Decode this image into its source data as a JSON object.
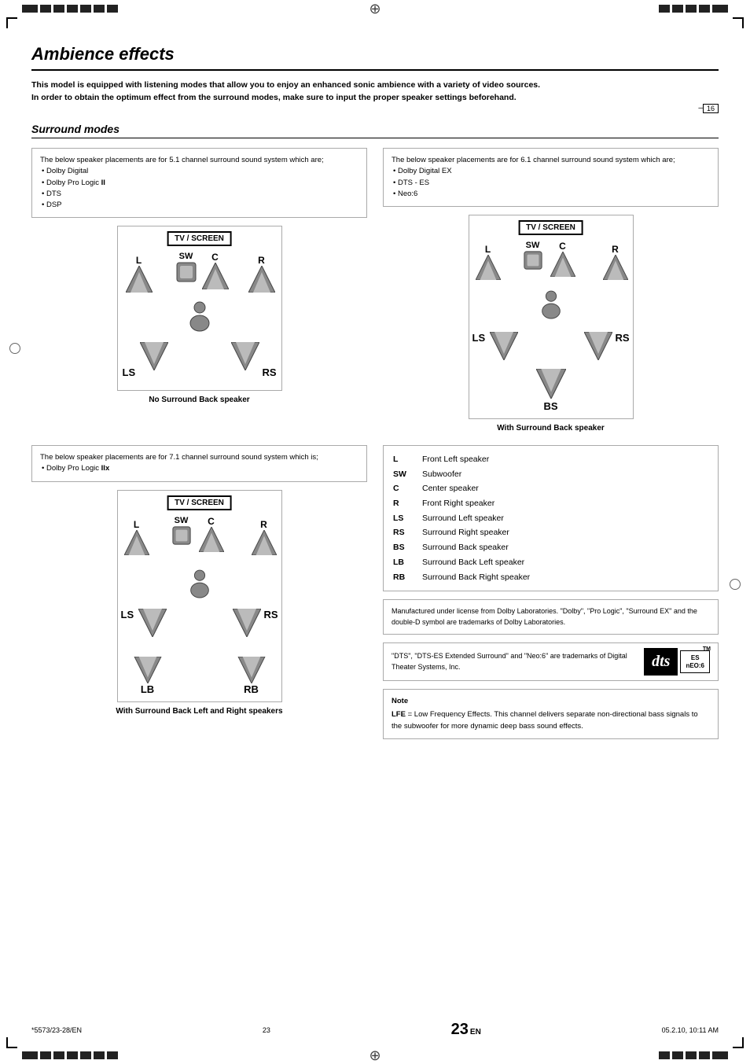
{
  "header": {
    "title": "Ambience effects",
    "section": "Surround modes"
  },
  "intro": {
    "line1": "This model is equipped with listening modes that allow you to enjoy an enhanced sonic ambience with a variety of video sources.",
    "line2": "In order to obtain the optimum effect from the surround modes, make sure to input the proper speaker settings beforehand.",
    "page_ref": "16"
  },
  "box_5_1": {
    "text": "The below speaker placements are for 5.1 channel surround sound system which are;",
    "items": [
      "Dolby Digital",
      "Dolby Pro Logic II",
      "DTS",
      "DSP"
    ]
  },
  "box_6_1": {
    "text": "The below speaker placements are for 6.1 channel surround sound system which are;",
    "items": [
      "Dolby Digital EX",
      "DTS - ES",
      "Neo:6"
    ]
  },
  "box_7_1": {
    "text": "The below speaker placements are for 7.1 channel surround sound system which is;",
    "items": [
      "Dolby Pro Logic IIx"
    ]
  },
  "diagrams": {
    "tv_screen": "TV / SCREEN",
    "caption_no_back": "No Surround Back speaker",
    "caption_with_back": "With Surround Back speaker",
    "caption_lb_rb": "With Surround Back Left and Right speakers"
  },
  "speaker_labels": {
    "L": "L",
    "SW": "SW",
    "C": "C",
    "R": "R",
    "LS": "LS",
    "RS": "RS",
    "BS": "BS",
    "LB": "LB",
    "RB": "RB"
  },
  "legend": {
    "rows": [
      {
        "key": "L",
        "value": "Front Left speaker"
      },
      {
        "key": "SW",
        "value": "Subwoofer"
      },
      {
        "key": "C",
        "value": "Center speaker"
      },
      {
        "key": "R",
        "value": "Front Right speaker"
      },
      {
        "key": "LS",
        "value": "Surround Left speaker"
      },
      {
        "key": "RS",
        "value": "Surround Right speaker"
      },
      {
        "key": "BS",
        "value": "Surround Back speaker"
      },
      {
        "key": "LB",
        "value": "Surround Back Left speaker"
      },
      {
        "key": "RB",
        "value": "Surround Back Right speaker"
      }
    ]
  },
  "dolby_note": {
    "text": "Manufactured under license from Dolby Laboratories. \"Dolby\", \"Pro Logic\", \"Surround EX\" and the double-D symbol are trademarks of Dolby Laboratories."
  },
  "dts_note": {
    "text": "\"DTS\", \"DTS-ES Extended Surround\" and \"Neo:6\" are trademarks of Digital Theater Systems, Inc.",
    "logo_text": "dts",
    "logo_es": "ES",
    "logo_neo": "nEO:6",
    "tm": "TM"
  },
  "note_section": {
    "label": "Note",
    "lfe_text": "LFE = Low Frequency Effects. This channel delivers separate non-directional bass signals to the subwoofer for more dynamic deep bass sound effects."
  },
  "page_number": "23",
  "page_suffix": "EN",
  "footer": {
    "left": "*5573/23-28/EN",
    "center": "23",
    "right": "05.2.10, 10:11 AM"
  }
}
